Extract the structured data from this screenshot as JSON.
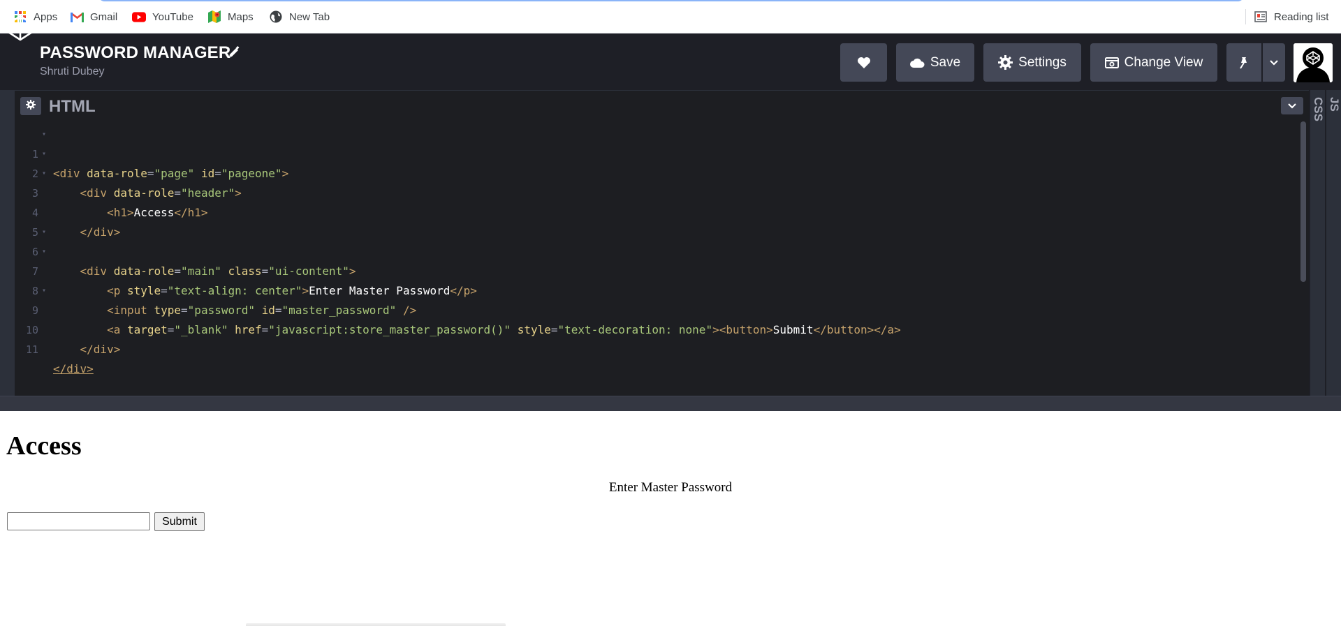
{
  "bookmarks": {
    "items": [
      {
        "label": "Apps",
        "icon": "apps-grid-icon"
      },
      {
        "label": "Gmail",
        "icon": "gmail-icon"
      },
      {
        "label": "YouTube",
        "icon": "youtube-icon"
      },
      {
        "label": "Maps",
        "icon": "maps-icon"
      },
      {
        "label": "New Tab",
        "icon": "globe-icon"
      }
    ],
    "reading_list": "Reading list"
  },
  "pen": {
    "title": "PASSWORD MANAGER",
    "author": "Shruti Dubey"
  },
  "toolbar": {
    "save_label": "Save",
    "settings_label": "Settings",
    "change_view_label": "Change View"
  },
  "editor": {
    "title": "HTML",
    "side_tabs": [
      "JS",
      "CSS"
    ],
    "lines": [
      {
        "n": "1",
        "fold": true
      },
      {
        "n": "2",
        "fold": true
      },
      {
        "n": "3",
        "fold": true
      },
      {
        "n": "4",
        "fold": false
      },
      {
        "n": "5",
        "fold": false
      },
      {
        "n": "6",
        "fold": true
      },
      {
        "n": "7",
        "fold": true
      },
      {
        "n": "8",
        "fold": false
      },
      {
        "n": "9",
        "fold": true
      },
      {
        "n": "10",
        "fold": false
      },
      {
        "n": "11",
        "fold": false
      }
    ],
    "code": {
      "l1": {
        "open": "<div",
        "a1": "data-role",
        "v1": "\"page\"",
        "a2": "id",
        "v2": "\"pageone\"",
        "close": ">"
      },
      "l2": {
        "open": "<div",
        "a1": "data-role",
        "v1": "\"header\"",
        "close": ">"
      },
      "l3": {
        "open": "<h1>",
        "text": "Access",
        "close": "</h1>"
      },
      "l4": {
        "close": "</div>"
      },
      "l6": {
        "open": "<div",
        "a1": "data-role",
        "v1": "\"main\"",
        "a2": "class",
        "v2": "\"ui-content\"",
        "close": ">"
      },
      "l7": {
        "open": "<p",
        "a1": "style",
        "v1": "\"text-align: center\"",
        "close": ">",
        "text": "Enter Master Password",
        "end": "</p>"
      },
      "l8": {
        "open": "<input",
        "a1": "type",
        "v1": "\"password\"",
        "a2": "id",
        "v2": "\"master_password\"",
        "close": "/>"
      },
      "l9": {
        "open": "<a",
        "a1": "target",
        "v1": "\"_blank\"",
        "a2": "href",
        "v2": "\"javascript:store_master_password()\"",
        "a3": "style",
        "v3": "\"text-decoration: none\"",
        "close": ">",
        "btn_open": "<button>",
        "text": "Submit",
        "btn_close": "</button>",
        "end": "</a>"
      },
      "l10": {
        "close": "</div>"
      },
      "l11": {
        "close": "</div>"
      }
    }
  },
  "preview": {
    "heading": "Access",
    "paragraph": "Enter Master Password",
    "submit_label": "Submit",
    "password_value": ""
  },
  "colors": {
    "header_bg": "#1e1f26",
    "button_bg": "#444857",
    "editor_bg": "#1d1e22",
    "tag": "#c7a36b",
    "attr": "#e8d38b",
    "string": "#a8c77a"
  }
}
